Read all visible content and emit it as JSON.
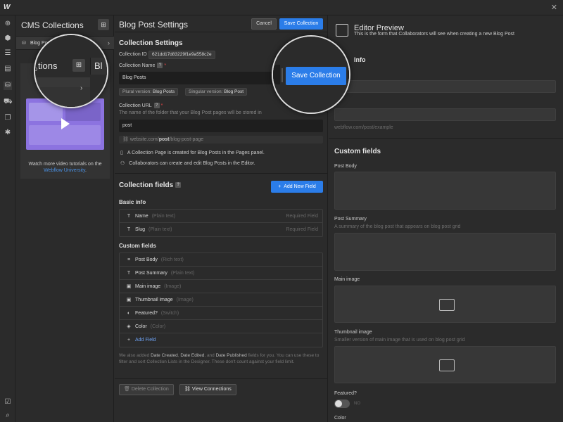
{
  "app": {
    "logo": "W"
  },
  "cms_panel": {
    "title": "CMS Collections",
    "collection_item": "Blog Posts",
    "video_caption": "Watch more video tutorials on the",
    "video_link": "Webflow University",
    "video_link_suffix": "."
  },
  "settings": {
    "title": "Blog Post Settings",
    "cancel_label": "Cancel",
    "save_label": "Save Collection",
    "section_title": "Collection Settings",
    "collection_id_label": "Collection ID",
    "collection_id_value": "621dd17d83229f1e9a558c2e",
    "collection_name_label": "Collection Name",
    "collection_name_value": "Blog Posts",
    "plural_label": "Plural version:",
    "plural_value": "Blog Posts",
    "singular_label": "Singular version:",
    "singular_value": "Blog Post",
    "collection_url_label": "Collection URL",
    "collection_url_hint": "The name of the folder that your Blog Post pages will be stored in",
    "collection_url_value": "post",
    "url_preview_prefix": "website.com/",
    "url_preview_bold": "post",
    "url_preview_suffix": "/blog-post-page",
    "info_1": "A Collection Page is created for Blog Posts in the Pages panel.",
    "info_2": "Collaborators can create and edit Blog Posts in the Editor.",
    "fields_title": "Collection fields",
    "add_new_field_label": "Add New Field",
    "basic_info_title": "Basic info",
    "basic_fields": [
      {
        "name": "Name",
        "type": "(Plain text)",
        "note": "Required Field",
        "icon": "T"
      },
      {
        "name": "Slug",
        "type": "(Plain text)",
        "note": "Required Field",
        "icon": "T"
      }
    ],
    "custom_fields_title": "Custom fields",
    "custom_fields": [
      {
        "name": "Post Body",
        "type": "(Rich text)",
        "icon": "≡"
      },
      {
        "name": "Post Summary",
        "type": "(Plain text)",
        "icon": "T"
      },
      {
        "name": "Main image",
        "type": "(Image)",
        "icon": "▣"
      },
      {
        "name": "Thumbnail image",
        "type": "(Image)",
        "icon": "▣"
      },
      {
        "name": "Featured?",
        "type": "(Switch)",
        "icon": "◐"
      },
      {
        "name": "Color",
        "type": "(Color)",
        "icon": "◈"
      }
    ],
    "add_field_label": "Add Field",
    "footnote_pre": "We also added ",
    "footnote_b1": "Date Created",
    "footnote_c1": ", ",
    "footnote_b2": "Date Edited",
    "footnote_c2": ", and ",
    "footnote_b3": "Date Published",
    "footnote_post": " fields for you. You can use these to filter and sort Collection Lists in the Designer. These don't count against your field limit.",
    "delete_label": "Delete Collection",
    "view_connections_label": "View Connections"
  },
  "preview": {
    "title": "Editor Preview",
    "subtitle": "This is the form that Collaborators will see when creating a new Blog Post",
    "info_heading_partial": "Info",
    "url_example": "webflow.com/post/example",
    "custom_fields_title": "Custom fields",
    "post_body_label": "Post Body",
    "post_summary_label": "Post Summary",
    "post_summary_hint": "A summary of the blog post that appears on blog post grid",
    "main_image_label": "Main image",
    "thumbnail_label": "Thumbnail image",
    "thumbnail_hint": "Smaller version of main image that is used on blog post grid",
    "featured_label": "Featured?",
    "featured_state": "NO",
    "color_label": "Color"
  },
  "magnifier_left": {
    "text_a": "tions",
    "text_b": "Bl",
    "text_c": "D"
  },
  "magnifier_right": {
    "save_label": "Save Collection",
    "info_label": "Info"
  },
  "colors": {
    "accent": "#2b7de9",
    "video_thumb": "#8c73e0",
    "required": "#e54545"
  }
}
